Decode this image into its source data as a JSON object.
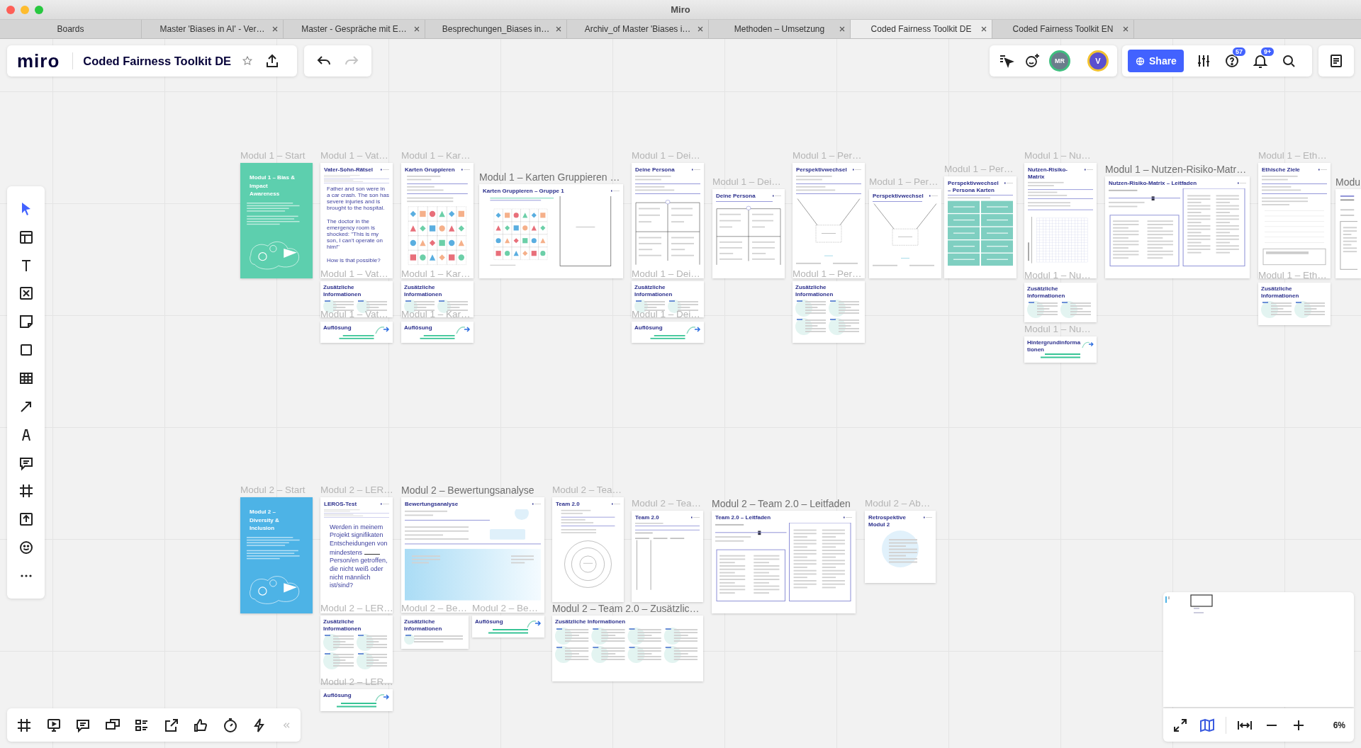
{
  "window": {
    "title": "Miro"
  },
  "tabs": [
    {
      "label": "Boards",
      "selected": false,
      "closable": false
    },
    {
      "label": "Master 'Biases in AI' - Ver…",
      "selected": false,
      "closable": true
    },
    {
      "label": "Master - Gespräche mit E…",
      "selected": false,
      "closable": true
    },
    {
      "label": "Besprechungen_Biases in…",
      "selected": false,
      "closable": true
    },
    {
      "label": "Archiv_of Master 'Biases i…",
      "selected": false,
      "closable": true
    },
    {
      "label": "Methoden – Umsetzung",
      "selected": false,
      "closable": true
    },
    {
      "label": "Coded Fairness Toolkit DE",
      "selected": true,
      "closable": true
    },
    {
      "label": "Coded Fairness Toolkit EN",
      "selected": false,
      "closable": true
    }
  ],
  "toolbar": {
    "logo": "miro",
    "board_title": "Coded Fairness Toolkit DE",
    "starred": false
  },
  "collaborators": [
    {
      "initials": "MR",
      "color": "#3fbf7f"
    },
    {
      "initials": "V",
      "color": "#f2c230"
    }
  ],
  "share_button": "Share",
  "help_badge": "57",
  "notifications_badge": "9+",
  "tools": [
    {
      "kind": "select",
      "selected": true
    },
    {
      "kind": "templates",
      "selected": false
    },
    {
      "kind": "text",
      "selected": false
    },
    {
      "kind": "card",
      "selected": false
    },
    {
      "kind": "sticky",
      "selected": false
    },
    {
      "kind": "shape",
      "selected": false
    },
    {
      "kind": "table",
      "selected": false
    },
    {
      "kind": "arrow",
      "selected": false
    },
    {
      "kind": "pen",
      "selected": false
    },
    {
      "kind": "comment",
      "selected": false
    },
    {
      "kind": "frame",
      "selected": false
    },
    {
      "kind": "upload",
      "selected": false
    },
    {
      "kind": "emoji",
      "selected": false
    },
    {
      "kind": "more",
      "selected": false
    }
  ],
  "bottom_tools": [
    {
      "kind": "frame"
    },
    {
      "kind": "present"
    },
    {
      "kind": "comment"
    },
    {
      "kind": "chat"
    },
    {
      "kind": "list"
    },
    {
      "kind": "share"
    },
    {
      "kind": "thumbs"
    },
    {
      "kind": "timer"
    },
    {
      "kind": "lightning"
    },
    {
      "kind": "collapse"
    }
  ],
  "zoom_level": "6%",
  "frames": [
    {
      "title": "Modul 1 – Start",
      "strong": false,
      "card": {
        "kind": "cover",
        "heading": "Modul 1 – Bias & Impact Awareness",
        "color": "#5dcfae"
      }
    },
    {
      "title": "Modul 1 – Vat…",
      "strong": false,
      "card": {
        "kind": "doc",
        "figure": {
          "kind": "riddle"
        },
        "heading": "Vater-Sohn-Rätsel",
        "text": "Father and son were in a car crash. The son has severe injuries and is brought to the hospital.\n\nThe doctor in the emergency room is shocked: \"This is my son, I can't operate on him!\"\n\nHow is that possible?"
      }
    },
    {
      "title": "Modul 1 – Kar…",
      "strong": false,
      "card": {
        "kind": "doc",
        "figure": {
          "kind": "shapes"
        },
        "heading": "Karten Gruppieren"
      }
    },
    {
      "title": "Modul 1 – Karten Gruppieren …",
      "strong": true,
      "card": {
        "kind": "doc",
        "figure": {
          "kind": "shapes-wide"
        },
        "heading": "Karten Gruppieren – Gruppe 1"
      }
    },
    {
      "title": "Modul 1 – Dei…",
      "strong": false,
      "card": {
        "kind": "doc",
        "figure": {
          "kind": "form"
        },
        "heading": "Deine Persona"
      }
    },
    {
      "title": "Modul 1 – Dei…",
      "strong": false,
      "card": {
        "kind": "doc",
        "figure": {
          "kind": "form-short"
        },
        "heading": "Deine Persona"
      }
    },
    {
      "title": "Modul 1 – Per…",
      "strong": false,
      "card": {
        "kind": "doc",
        "figure": {
          "kind": "diagram"
        },
        "heading": "Perspektivwechsel"
      }
    },
    {
      "title": "Modul 1 – Per…",
      "strong": false,
      "card": {
        "kind": "doc",
        "figure": {
          "kind": "diagram-short"
        },
        "heading": "Perspektivwechsel"
      }
    },
    {
      "title": "Modul 1 – Per…",
      "strong": false,
      "card": {
        "kind": "doc",
        "figure": {
          "kind": "teal-grid"
        },
        "heading": "Perspektivwechsel – Persona Karten"
      }
    },
    {
      "title": "Modul 1 – Nu…",
      "strong": false,
      "card": {
        "kind": "doc",
        "figure": {
          "kind": "matrix"
        },
        "heading": "Nutzen-Risiko-Matrix"
      }
    },
    {
      "title": "Modul 1 – Nutzen-Risiko-Matr…",
      "strong": true,
      "card": {
        "kind": "doc",
        "figure": {
          "kind": "leitfaden"
        },
        "heading": "Nutzen-Risiko-Matrix – Leitfaden"
      }
    },
    {
      "title": "Modul 1 – Eth…",
      "strong": false,
      "card": {
        "kind": "doc",
        "figure": {
          "kind": "goals"
        },
        "heading": "Ethische Ziele"
      }
    },
    {
      "title": "Modu",
      "strong": true,
      "card": {
        "kind": "edge"
      }
    },
    {
      "title": "Modul 1 – Vat…",
      "strong": false,
      "card": {
        "kind": "info",
        "heading": "Zusätzliche Informationen"
      }
    },
    {
      "title": "Modul 1 – Vat…",
      "strong": false,
      "card": {
        "kind": "solution",
        "heading": "Auflösung"
      }
    },
    {
      "title": "Modul 1 – Kar…",
      "strong": false,
      "card": {
        "kind": "info",
        "heading": "Zusätzliche Informationen"
      }
    },
    {
      "title": "Modul 1 – Kar…",
      "strong": false,
      "card": {
        "kind": "solution",
        "heading": "Auflösung"
      }
    },
    {
      "title": "Modul 1 – Dei…",
      "strong": false,
      "card": {
        "kind": "info",
        "heading": "Zusätzliche Informationen"
      }
    },
    {
      "title": "Modul 1 – Dei…",
      "strong": false,
      "card": {
        "kind": "solution",
        "heading": "Auflösung"
      }
    },
    {
      "title": "Modul 1 – Per…",
      "strong": false,
      "card": {
        "kind": "info",
        "heading": "Zusätzliche Informationen"
      }
    },
    {
      "title": "Modul 1 – Nu…",
      "strong": false,
      "card": {
        "kind": "info",
        "heading": "Zusätzliche Informationen"
      }
    },
    {
      "title": "Modul 1 – Nu…",
      "strong": false,
      "card": {
        "kind": "solution",
        "heading": "Hintergrundinformationen"
      }
    },
    {
      "title": "Modul 1 – Eth…",
      "strong": false,
      "card": {
        "kind": "info",
        "heading": "Zusätzliche Informationen"
      }
    },
    {
      "title": "Modul 2 – Start",
      "strong": false,
      "card": {
        "kind": "cover",
        "heading": "Modul 2 – Diversity & Inclusion",
        "color": "#4db3e6"
      }
    },
    {
      "title": "Modul 2 – LER…",
      "strong": false,
      "card": {
        "kind": "doc",
        "figure": {
          "kind": "question"
        },
        "heading": "LEROS-Test",
        "text": "Werden in meinem Projekt signifikaten Entscheidungen von mindestens",
        "text_after": "Person/en getroffen, die nicht weiß oder nicht männlich ist/sind?"
      }
    },
    {
      "title": "Modul 2 – Bewertungsanalyse",
      "strong": true,
      "card": {
        "kind": "doc",
        "figure": {
          "kind": "gradient"
        },
        "heading": "Bewertungsanalyse"
      }
    },
    {
      "title": "Modul 2 – Tea…",
      "strong": false,
      "card": {
        "kind": "doc",
        "figure": {
          "kind": "circles"
        },
        "heading": "Team 2.0"
      }
    },
    {
      "title": "Modul 2 – Tea…",
      "strong": false,
      "card": {
        "kind": "doc",
        "figure": {
          "kind": "columns"
        },
        "heading": "Team 2.0"
      }
    },
    {
      "title": "Modul 2 – Team 2.0 – Leitfaden",
      "strong": true,
      "card": {
        "kind": "doc",
        "figure": {
          "kind": "leitfaden"
        },
        "heading": "Team 2.0 – Leitfaden"
      }
    },
    {
      "title": "Modul 2 – Ab…",
      "strong": false,
      "card": {
        "kind": "doc",
        "figure": {
          "kind": "retro"
        },
        "heading": "Retrospektive Modul 2"
      }
    },
    {
      "title": "Modul 2 – LER…",
      "strong": false,
      "card": {
        "kind": "info",
        "heading": "Zusätzliche Informationen"
      }
    },
    {
      "title": "Modul 2 – LER…",
      "strong": false,
      "card": {
        "kind": "solution",
        "heading": "Auflösung"
      }
    },
    {
      "title": "Modul 2 – Be…",
      "strong": false,
      "card": {
        "kind": "info",
        "heading": "Zusätzliche Informationen"
      }
    },
    {
      "title": "Modul 2 – Be…",
      "strong": false,
      "card": {
        "kind": "solution",
        "heading": "Auflösung"
      }
    },
    {
      "title": "Modul 2 – Team 2.0 – Zusätzlic…",
      "strong": true,
      "card": {
        "kind": "info",
        "heading": "Zusätzliche Informationen"
      }
    }
  ]
}
